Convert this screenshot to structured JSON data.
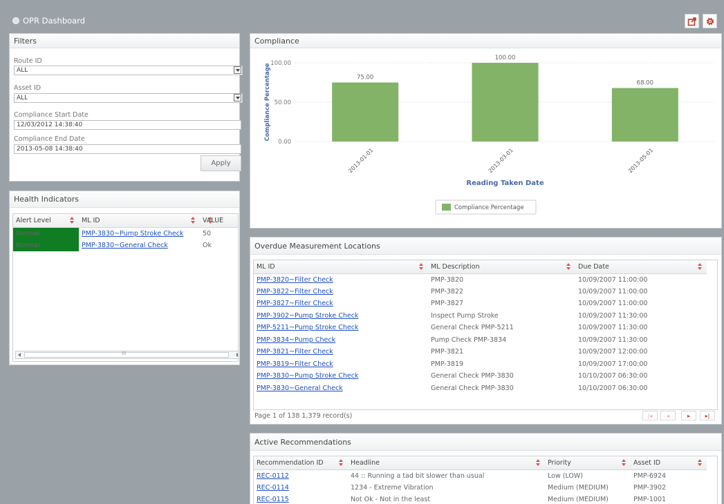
{
  "app": {
    "title": "OPR Dashboard"
  },
  "filters": {
    "title": "Filters",
    "route_label": "Route ID",
    "route_value": "ALL",
    "asset_label": "Asset ID",
    "asset_value": "ALL",
    "start_label": "Compliance Start Date",
    "start_value": "12/03/2012 14:38:40",
    "end_label": "Compliance End Date",
    "end_value": "2013-05-08 14:38:40",
    "apply_label": "Apply"
  },
  "health": {
    "title": "Health Indicators",
    "columns": [
      "Alert Level",
      "ML ID",
      "VALUE"
    ],
    "rows": [
      {
        "alert": "Normal",
        "ml_id": "PMP-3830~Pump Stroke Check",
        "value": "50"
      },
      {
        "alert": "Normal",
        "ml_id": "PMP-3830~General Check",
        "value": "Ok"
      }
    ],
    "scroll_glyph": "III"
  },
  "compliance": {
    "title": "Compliance",
    "legend_label": "Compliance Percentage",
    "colors": {
      "bar": "#82b366",
      "axis_title": "#4a6aa8"
    }
  },
  "chart_data": {
    "type": "bar",
    "categories": [
      "2013-01-01",
      "2013-03-01",
      "2013-05-01"
    ],
    "series": [
      {
        "name": "Compliance Percentage",
        "values": [
          75.0,
          100.0,
          68.0
        ]
      }
    ],
    "data_labels": [
      "75.00",
      "100.00",
      "68.00"
    ],
    "ytick_labels": [
      "100.00",
      "50.00",
      "0.00"
    ],
    "xlabel": "Reading Taken Date",
    "ylabel": "Compliance Percentage",
    "ylim": [
      0,
      100
    ],
    "legend": "bottom-center",
    "grid": true
  },
  "overdue": {
    "title": "Overdue Measurement Locations",
    "columns": [
      "ML ID",
      "ML Description",
      "Due Date"
    ],
    "rows": [
      [
        "PMP-3820~Filter Check",
        "PMP-3820",
        "10/09/2007 11:00:00"
      ],
      [
        "PMP-3822~Filter Check",
        "PMP-3822",
        "10/09/2007 11:00:00"
      ],
      [
        "PMP-3827~Filter Check",
        "PMP-3827",
        "10/09/2007 11:00:00"
      ],
      [
        "PMP-3902~Pump Stroke Check",
        "Inspect Pump Stroke",
        "10/09/2007 11:30:00"
      ],
      [
        "PMP-5211~Pump Stroke Check",
        "General Check PMP-5211",
        "10/09/2007 11:30:00"
      ],
      [
        "PMP-3834~Pump Check",
        "Pump Check PMP-3834",
        "10/09/2007 11:30:00"
      ],
      [
        "PMP-3821~Filter Check",
        "PMP-3821",
        "10/09/2007 12:00:00"
      ],
      [
        "PMP-3819~Filter Check",
        "PMP-3819",
        "10/09/2007 17:00:00"
      ],
      [
        "PMP-3830~Pump Stroke Check",
        "General Check PMP-3830",
        "10/10/2007 06:30:00"
      ],
      [
        "PMP-3830~General Check",
        "General Check PMP-3830",
        "10/10/2007 06:30:00"
      ]
    ],
    "pager_text": "Page 1 of 138   1,379 record(s)"
  },
  "recommendations": {
    "title": "Active Recommendations",
    "columns": [
      "Recommendation ID",
      "Headline",
      "Priority",
      "Asset ID"
    ],
    "rows": [
      [
        "REC-0112",
        "44 :: Running a tad bit slower than usual",
        "Low (LOW)",
        "PMP-6924"
      ],
      [
        "REC-0114",
        "1234 - Extreme Vibration",
        "Medium (MEDIUM)",
        "PMP-3902"
      ],
      [
        "REC-0115",
        "Not Ok - Not in the least",
        "Medium (MEDIUM)",
        "PMP-1001"
      ]
    ]
  }
}
